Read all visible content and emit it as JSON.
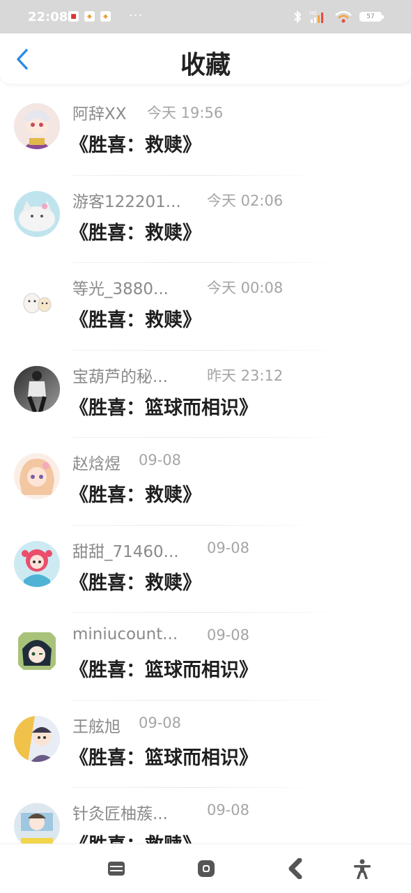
{
  "status_bar": {
    "time": "22:08",
    "notification_icons": [
      "app-notification-icon",
      "app-notification-icon",
      "app-notification-icon"
    ],
    "more": "···",
    "battery": "57",
    "network": "HD"
  },
  "header": {
    "title": "收藏",
    "back_icon": "chevron-left-icon"
  },
  "colors": {
    "accent": "#2b8ce6",
    "status_bar_bg": "#d8d8d8",
    "name_gray": "#8a8a8a",
    "time_gray": "#a5a5a5"
  },
  "favorites": [
    {
      "name": "阿辞XX",
      "time": "今天 19:56",
      "title": "《胜喜：救赎》"
    },
    {
      "name": "游客122201...",
      "time": "今天 02:06",
      "title": "《胜喜：救赎》"
    },
    {
      "name": "等光_3880...",
      "time": "今天 00:08",
      "title": "《胜喜：救赎》"
    },
    {
      "name": "宝葫芦的秘...",
      "time": "昨天 23:12",
      "title": "《胜喜：篮球而相识》"
    },
    {
      "name": "赵焓煜",
      "time": "09-08",
      "title": "《胜喜：救赎》"
    },
    {
      "name": "甜甜_71460...",
      "time": "09-08",
      "title": "《胜喜：救赎》"
    },
    {
      "name": "miniucount...",
      "time": "09-08",
      "title": "《胜喜：篮球而相识》"
    },
    {
      "name": "王舷旭",
      "time": "09-08",
      "title": "《胜喜：篮球而相识》"
    },
    {
      "name": "针灸匠柚蔟...",
      "time": "09-08",
      "title": "《胜喜：救赎》"
    }
  ],
  "nav_bar": {
    "buttons": [
      "menu-icon",
      "home-icon",
      "back-icon",
      "accessibility-icon"
    ]
  }
}
